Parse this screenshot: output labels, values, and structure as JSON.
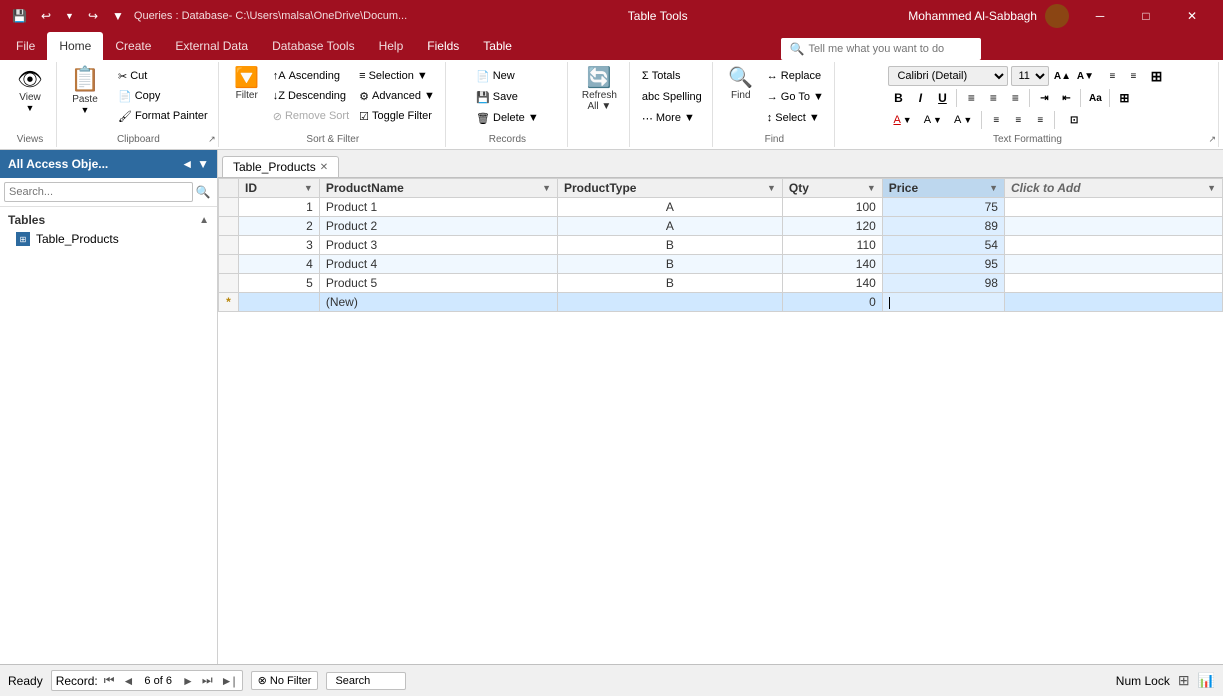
{
  "titleBar": {
    "appIcon": "💾",
    "undoBtn": "↩",
    "redoBtn": "↪",
    "customizeBtn": "▼",
    "title": "Queries : Database- C:\\Users\\malsa\\OneDrive\\Docum...",
    "centerTitle": "Table Tools",
    "userName": "Mohammed Al-Sabbagh",
    "minimizeBtn": "─",
    "restoreBtn": "□",
    "closeBtn": "✕"
  },
  "ribbonTabs": {
    "tabs": [
      {
        "label": "File",
        "active": false
      },
      {
        "label": "Home",
        "active": true
      },
      {
        "label": "Create",
        "active": false
      },
      {
        "label": "External Data",
        "active": false
      },
      {
        "label": "Database Tools",
        "active": false
      },
      {
        "label": "Help",
        "active": false
      },
      {
        "label": "Fields",
        "active": false
      },
      {
        "label": "Table",
        "active": false
      }
    ],
    "searchPlaceholder": "Tell me what you want to do",
    "searchIcon": "🔍"
  },
  "ribbon": {
    "groups": [
      {
        "name": "Views",
        "label": "Views",
        "items": [
          {
            "type": "large-btn",
            "icon": "👁",
            "label": "View"
          }
        ]
      },
      {
        "name": "Clipboard",
        "label": "Clipboard",
        "items": [
          {
            "type": "large-btn",
            "icon": "📋",
            "label": "Paste"
          },
          {
            "type": "small-btn",
            "icon": "✂",
            "label": "Cut"
          },
          {
            "type": "small-btn",
            "icon": "📄",
            "label": "Copy"
          },
          {
            "type": "small-btn",
            "icon": "🖌",
            "label": "Format Painter"
          }
        ]
      },
      {
        "name": "Sort & Filter",
        "label": "Sort & Filter",
        "items": [
          {
            "type": "large-btn",
            "icon": "🔽",
            "label": "Filter"
          },
          {
            "type": "small-btn",
            "label": "↑ Ascending"
          },
          {
            "type": "small-btn",
            "label": "↓ Descending"
          },
          {
            "type": "small-btn",
            "label": "Remove Sort"
          },
          {
            "type": "small-btn",
            "label": "≡ Selection ▼"
          },
          {
            "type": "small-btn",
            "label": "⚙ Advanced ▼"
          },
          {
            "type": "small-btn",
            "label": "☑ Toggle Filter"
          }
        ]
      },
      {
        "name": "Records",
        "label": "Records",
        "items": [
          {
            "type": "small-btn",
            "icon": "📄",
            "label": "New"
          },
          {
            "type": "small-btn",
            "icon": "💾",
            "label": "Save"
          },
          {
            "type": "small-btn",
            "icon": "🗑",
            "label": "Delete ▼"
          }
        ]
      },
      {
        "name": "RefreshAll",
        "label": "",
        "items": [
          {
            "type": "large-btn",
            "icon": "🔄",
            "label": "Refresh\nAll ▼"
          }
        ]
      },
      {
        "name": "Summary",
        "label": "",
        "items": [
          {
            "type": "small-btn",
            "label": "Σ Totals"
          },
          {
            "type": "small-btn",
            "label": "abc Spelling"
          },
          {
            "type": "small-btn",
            "label": "⋯ More ▼"
          }
        ]
      },
      {
        "name": "Find",
        "label": "Find",
        "items": [
          {
            "type": "large-btn",
            "icon": "🔍",
            "label": "Find"
          },
          {
            "type": "small-btn",
            "label": "ab→ Replace"
          },
          {
            "type": "small-btn",
            "label": "→ Go To ▼"
          },
          {
            "type": "small-btn",
            "label": "↕ Select ▼"
          }
        ]
      },
      {
        "name": "TextFormatting",
        "label": "Text Formatting",
        "fontName": "Calibri (Detail)",
        "fontSize": "11",
        "bold": "B",
        "italic": "I",
        "underline": "U",
        "alignLeft": "≡",
        "alignCenter": "≡",
        "alignRight": "≡",
        "fontColor": "A",
        "highlightColor": "A",
        "bgColor": "A"
      }
    ]
  },
  "sidebar": {
    "title": "All Access Obje...",
    "searchPlaceholder": "Search...",
    "sections": [
      {
        "name": "Tables",
        "expanded": true,
        "items": [
          {
            "name": "Table_Products",
            "icon": "table",
            "selected": false
          }
        ]
      }
    ]
  },
  "tab": {
    "label": "Table_Products",
    "closeIcon": "✕"
  },
  "tableHeaders": [
    "ID",
    "ProductName",
    "ProductType",
    "Qty",
    "Price",
    "Click to Add"
  ],
  "tableData": [
    {
      "id": 1,
      "name": "Product 1",
      "type": "A",
      "qty": 100,
      "price": 75,
      "selector": ""
    },
    {
      "id": 2,
      "name": "Product 2",
      "type": "A",
      "qty": 120,
      "price": 89,
      "selector": ""
    },
    {
      "id": 3,
      "name": "Product 3",
      "type": "B",
      "qty": 110,
      "price": 54,
      "selector": ""
    },
    {
      "id": 4,
      "name": "Product 4",
      "type": "B",
      "qty": 140,
      "price": 95,
      "selector": ""
    },
    {
      "id": 5,
      "name": "Product 5",
      "type": "B",
      "qty": 140,
      "price": 98,
      "selector": ""
    }
  ],
  "newRow": {
    "symbol": "*",
    "id": "",
    "name": "(New)",
    "type": "",
    "qty": 0,
    "price": ""
  },
  "statusBar": {
    "ready": "Ready",
    "recordLabel": "Record:",
    "recordCurrent": "6 of 6",
    "noFilter": "No Filter",
    "search": "Search",
    "numLock": "Num Lock",
    "navFirst": "⏮",
    "navPrev": "◄",
    "navNext": "►",
    "navLast": "⏭",
    "navNew": "►|"
  }
}
